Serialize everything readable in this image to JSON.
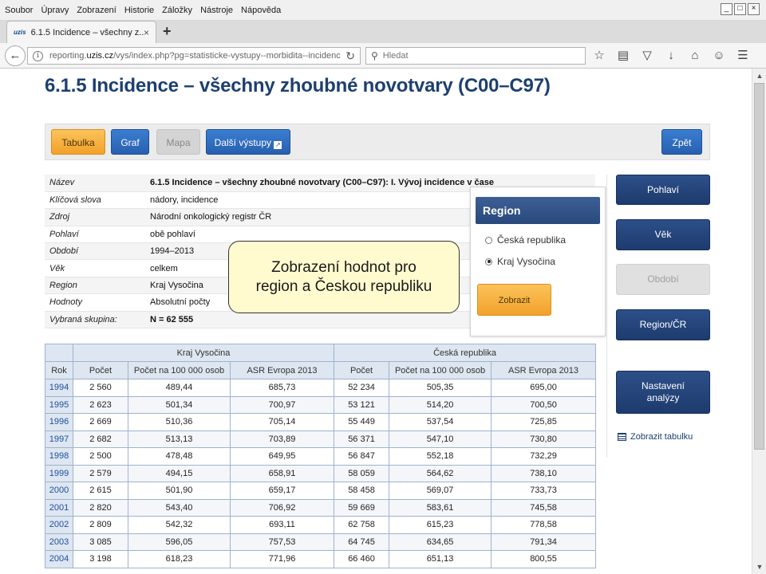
{
  "menu": [
    "Soubor",
    "Úpravy",
    "Zobrazení",
    "Historie",
    "Záložky",
    "Nástroje",
    "Nápověda"
  ],
  "window_controls": [
    "_",
    "□",
    "×"
  ],
  "tab": {
    "favicon": "uzis",
    "title": "6.1.5 Incidence – všechny z...",
    "close": "×"
  },
  "newtab": "+",
  "address": {
    "prefix": "reporting.",
    "host": "uzis.cz",
    "path": "/vys/index.php?pg=statisticke-vystupy--morbidita--incidence-dle"
  },
  "search": {
    "placeholder": "Hledat"
  },
  "toolbar_icons": [
    "star-icon",
    "library-icon",
    "pocket-icon",
    "download-icon",
    "home-icon",
    "smiley-icon",
    "menu-icon"
  ],
  "page": {
    "title": "6.1.5 Incidence – všechny zhoubné novotvary (C00–C97)"
  },
  "buttons": {
    "tabulka": "Tabulka",
    "graf": "Graf",
    "mapa": "Mapa",
    "dalsi": "Další výstupy",
    "zpet": "Zpět"
  },
  "info": [
    {
      "key": "Název",
      "value": "6.1.5 Incidence – všechny zhoubné novotvary (C00–C97): I. Vývoj incidence v čase"
    },
    {
      "key": "Klíčová slova",
      "value": "nádory, incidence"
    },
    {
      "key": "Zdroj",
      "value": "Národní onkologický registr ČR"
    },
    {
      "key": "Pohlaví",
      "value": "obě pohlaví"
    },
    {
      "key": "Období",
      "value": "1994–2013"
    },
    {
      "key": "Věk",
      "value": "celkem"
    },
    {
      "key": "Region",
      "value": "Kraj Vysočina"
    },
    {
      "key": "Hodnoty",
      "value": "Absolutní počty"
    },
    {
      "key": "Vybraná skupina:",
      "value": "N = 62 555"
    }
  ],
  "region_popup": {
    "title": "Region",
    "options": [
      "Česká republika",
      "Kraj Vysočina"
    ],
    "selected": "Kraj Vysočina",
    "submit": "Zobrazit"
  },
  "annotation": {
    "line1": "Zobrazení hodnot pro",
    "line2": "region a Českou republiku"
  },
  "table": {
    "group_left": "Kraj Vysočina",
    "group_right": "Česká republika",
    "headers": [
      "Rok",
      "Počet",
      "Počet na 100 000 osob",
      "ASR Evropa 2013",
      "Počet",
      "Počet na 100 000 osob",
      "ASR Evropa 2013"
    ],
    "rows": [
      [
        "1994",
        "2 560",
        "489,44",
        "685,73",
        "52 234",
        "505,35",
        "695,00"
      ],
      [
        "1995",
        "2 623",
        "501,34",
        "700,97",
        "53 121",
        "514,20",
        "700,50"
      ],
      [
        "1996",
        "2 669",
        "510,36",
        "705,14",
        "55 449",
        "537,54",
        "725,85"
      ],
      [
        "1997",
        "2 682",
        "513,13",
        "703,89",
        "56 371",
        "547,10",
        "730,80"
      ],
      [
        "1998",
        "2 500",
        "478,48",
        "649,95",
        "56 847",
        "552,18",
        "732,29"
      ],
      [
        "1999",
        "2 579",
        "494,15",
        "658,91",
        "58 059",
        "564,62",
        "738,10"
      ],
      [
        "2000",
        "2 615",
        "501,90",
        "659,17",
        "58 458",
        "569,07",
        "733,73"
      ],
      [
        "2001",
        "2 820",
        "543,40",
        "706,92",
        "59 669",
        "583,61",
        "745,58"
      ],
      [
        "2002",
        "2 809",
        "542,32",
        "693,11",
        "62 758",
        "615,23",
        "778,58"
      ],
      [
        "2003",
        "3 085",
        "596,05",
        "757,53",
        "64 745",
        "634,65",
        "791,34"
      ],
      [
        "2004",
        "3 198",
        "618,23",
        "771,96",
        "66 460",
        "651,13",
        "800,55"
      ]
    ]
  },
  "sidenav": {
    "pohlavi": "Pohlaví",
    "vek": "Věk",
    "obdobi": "Období",
    "region_cr": "Region/ČR",
    "nastaveni_1": "Nastavení",
    "nastaveni_2": "analýzy",
    "zobrazit_tabulku": "Zobrazit tabulku"
  }
}
